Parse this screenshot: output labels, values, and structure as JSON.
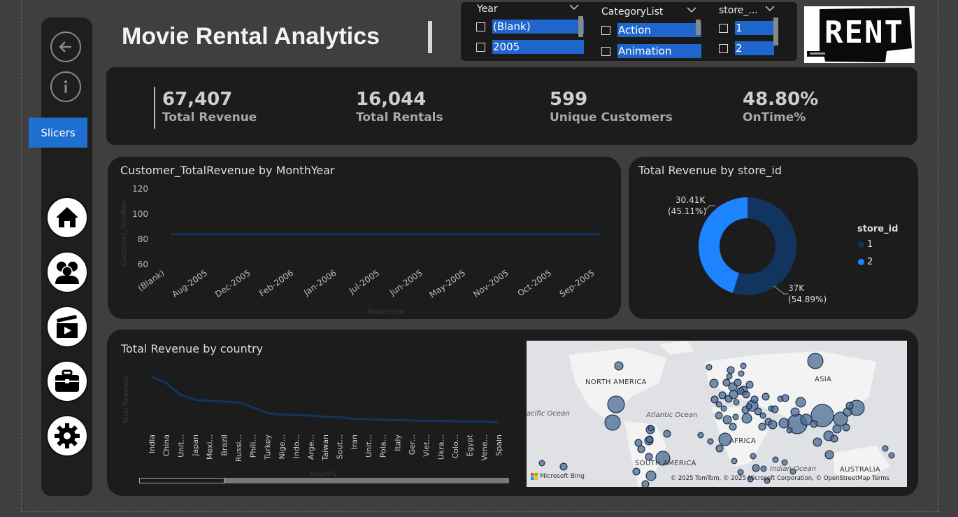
{
  "title": "Movie Rental Analytics",
  "nav": {
    "slicers_label": "Slicers"
  },
  "slicers": [
    {
      "name": "Year",
      "options": [
        "(Blank)",
        "2005"
      ]
    },
    {
      "name": "CategoryList",
      "options": [
        "Action",
        "Animation"
      ]
    },
    {
      "name": "store_...",
      "options": [
        "1",
        "2"
      ]
    }
  ],
  "logo_text": "RENT",
  "kpis": [
    {
      "value": "67,407",
      "label": "Total Revenue"
    },
    {
      "value": "16,044",
      "label": "Total Rentals"
    },
    {
      "value": "599",
      "label": "Unique Customers"
    },
    {
      "value": "48.80%",
      "label": "OnTime%"
    }
  ],
  "chart_data": [
    {
      "type": "line",
      "title": "Customer_TotalRevenue by MonthYear",
      "xlabel": "MonthYear",
      "ylabel": "Customer_TotalRev...",
      "categories": [
        "(Blank)",
        "Aug-2005",
        "Dec-2005",
        "Feb-2006",
        "Jan-2006",
        "Jul-2005",
        "Jun-2005",
        "May-2005",
        "Nov-2005",
        "Oct-2005",
        "Sep-2005"
      ],
      "values": [
        84,
        84,
        84,
        84,
        84,
        84,
        84,
        84,
        84,
        84,
        84
      ],
      "yticks": [
        "120",
        "100",
        "80",
        "60"
      ],
      "ylim": [
        60,
        120
      ],
      "color": "#12355f"
    },
    {
      "type": "pie",
      "title": "Total Revenue by store_id",
      "legend_title": "store_id",
      "slices": [
        {
          "name": "1",
          "value": 37000,
          "label": "37K",
          "pct": "(54.89%)",
          "color": "#12355f"
        },
        {
          "name": "2",
          "value": 30410,
          "label": "30.41K",
          "pct": "(45.11%)",
          "color": "#1c84ff"
        }
      ]
    },
    {
      "type": "line",
      "title": "Total Revenue by country",
      "xlabel": "country",
      "ylabel": "Total Revenue",
      "categories": [
        "India",
        "China",
        "Unit...",
        "Japan",
        "Mexi...",
        "Brazil",
        "Russi...",
        "Phili...",
        "Turkey",
        "Nige...",
        "Indo...",
        "Arge...",
        "Taiwan",
        "Sout...",
        "Iran",
        "Unit...",
        "Pola...",
        "Italy",
        "Ger...",
        "Viet...",
        "Ukra...",
        "Colo...",
        "Egypt",
        "Vene...",
        "Spain"
      ],
      "values": [
        6630,
        5800,
        4200,
        3550,
        3400,
        3300,
        3200,
        2500,
        1750,
        1550,
        1500,
        1400,
        1250,
        1200,
        950,
        900,
        850,
        800,
        750,
        700,
        680,
        650,
        620,
        580,
        480
      ],
      "color": "#12355f"
    }
  ],
  "map": {
    "labels": [
      "NORTH AMERICA",
      "ASIA",
      "AFRICA",
      "SOUTH AMERICA",
      "AUSTRALIA"
    ],
    "oceans": [
      "acific Ocean",
      "Atlantic Ocean",
      "Indian Ocean"
    ],
    "brand": "Microsoft Bing",
    "footer": "© 2025 TomTom, © 2025 Microsoft Corporation, © OpenStreetMap Terms"
  }
}
